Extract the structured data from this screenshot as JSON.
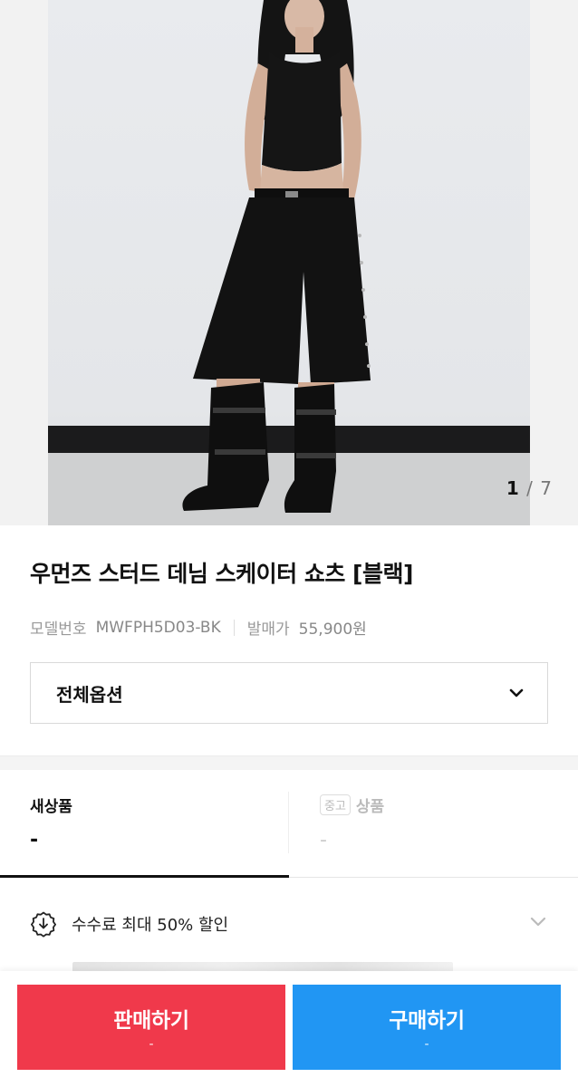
{
  "product": {
    "image_counter": {
      "current": "1",
      "separator": "/",
      "total": "7"
    },
    "title": "우먼즈 스터드 데님 스케이터 쇼츠 [블랙]",
    "model_label": "모델번호",
    "model_number": "MWFPH5D03-BK",
    "release_price_label": "발매가",
    "release_price": "55,900원"
  },
  "option_select": {
    "label": "전체옵션",
    "icon": "chevron-down-icon"
  },
  "tabs": {
    "new": {
      "label": "새상품",
      "price": "-"
    },
    "used": {
      "badge": "중고",
      "label": "상품",
      "price": "-"
    }
  },
  "fee_banner": {
    "text": "수수료 최대 50% 할인",
    "icon": "discount-download-icon"
  },
  "actions": {
    "sell": {
      "label": "판매하기",
      "sub": "-",
      "color": "#f0394b"
    },
    "buy": {
      "label": "구매하기",
      "sub": "-",
      "color": "#2196f3"
    }
  }
}
